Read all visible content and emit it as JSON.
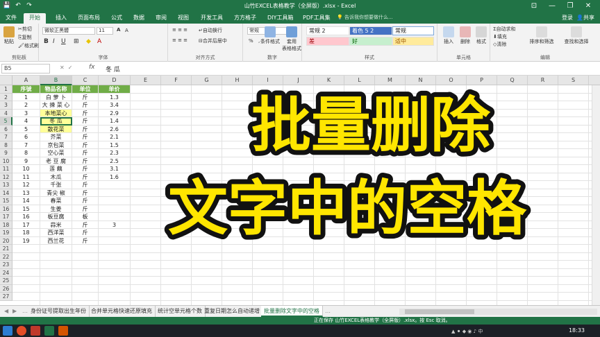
{
  "window": {
    "title": "山竹EXCEL表格教学（全屏版）.xlsx - Excel",
    "save_icon": "save-icon",
    "undo_icon": "undo-icon",
    "redo_icon": "redo-icon"
  },
  "ribbon_tabs": [
    "文件",
    "开始",
    "插入",
    "页面布局",
    "公式",
    "数据",
    "审阅",
    "视图",
    "开发工具",
    "方方格子",
    "DIY工具箱",
    "PDF工具集"
  ],
  "tell_me": "告诉我你想要做什么...",
  "account": {
    "login": "登录",
    "share": "共享"
  },
  "ribbon": {
    "clipboard": {
      "paste": "粘贴",
      "cut": "剪切",
      "copy": "复制",
      "format_painter": "格式刷",
      "label": "剪贴板"
    },
    "font": {
      "name": "微软正黑體",
      "size": "11",
      "grow": "A",
      "shrink": "A",
      "bold": "B",
      "italic": "I",
      "underline": "U",
      "label": "字体"
    },
    "align": {
      "wrap": "自动换行",
      "merge": "合并后居中",
      "label": "对齐方式"
    },
    "number": {
      "format": "常规",
      "pct": "%",
      "comma": ",",
      "label": "数字"
    },
    "styles": {
      "cond": "条件格式",
      "table": "套用\n表格格式",
      "label": "样式",
      "items": [
        "常规 2",
        "着色 5 2",
        "常规",
        "差",
        "好",
        "适中"
      ],
      "colors": {
        "bad": "#ffc7ce",
        "good": "#c6efce",
        "neutral": "#ffeb9c",
        "accent": "#4472c4"
      }
    },
    "cells": {
      "insert": "插入",
      "delete": "删除",
      "format": "格式",
      "label": "单元格"
    },
    "editing": {
      "autosum": "自动求和",
      "fill": "填充",
      "clear": "清除",
      "sort": "排序和筛选",
      "find": "查找和选择",
      "label": "编辑"
    }
  },
  "formula_bar": {
    "name_box": "B5",
    "fx": "fx",
    "value": "冬 瓜"
  },
  "columns": [
    "A",
    "B",
    "C",
    "D",
    "E",
    "F",
    "G",
    "H",
    "I",
    "J",
    "K",
    "L",
    "M",
    "N",
    "O",
    "P",
    "Q",
    "R",
    "S",
    "T"
  ],
  "rows": [
    "1",
    "2",
    "3",
    "4",
    "5",
    "6",
    "7",
    "8",
    "9",
    "10",
    "11",
    "12",
    "13",
    "14",
    "15",
    "16",
    "17",
    "18",
    "19",
    "20",
    "21",
    "22",
    "23",
    "24",
    "25",
    "26",
    "27"
  ],
  "table": {
    "headers": [
      "序號",
      "物品名称",
      "单位",
      "单价"
    ],
    "rows": [
      [
        "1",
        "白 萝 卜",
        "斤",
        "1.3"
      ],
      [
        "2",
        "大 揀 菜 心",
        "斤",
        "3.4"
      ],
      [
        "3",
        "本地菜心",
        "斤",
        "2.9"
      ],
      [
        "4",
        "冬 瓜",
        "斤",
        "1.4"
      ],
      [
        "5",
        "散花菜",
        "斤",
        "2.6"
      ],
      [
        "6",
        "芥菜",
        "斤",
        "2.1"
      ],
      [
        "7",
        "京包菜",
        "斤",
        "1.5"
      ],
      [
        "8",
        "空心菜",
        "斤",
        "2.3"
      ],
      [
        "9",
        "老 豆 腐",
        "斤",
        "2.5"
      ],
      [
        "10",
        "莲 藕",
        "斤",
        "3.1"
      ],
      [
        "11",
        "木瓜",
        "斤",
        "1.6"
      ],
      [
        "12",
        "千张",
        "斤",
        ""
      ],
      [
        "13",
        "青尖 椒",
        "斤",
        ""
      ],
      [
        "14",
        "春菜",
        "斤",
        ""
      ],
      [
        "15",
        "生姜",
        "斤",
        ""
      ],
      [
        "16",
        "板豆腐",
        "板",
        ""
      ],
      [
        "17",
        "蒜米",
        "斤",
        "3"
      ],
      [
        "18",
        "西洋菜",
        "斤",
        ""
      ],
      [
        "19",
        "西兰花",
        "斤",
        ""
      ]
    ]
  },
  "overlay": {
    "line1": "批量删除",
    "line2": "文字中的空格"
  },
  "sheet_tabs": [
    "身份证号提取出生年份",
    "合并单元格快速还原填充",
    "统计空单元格个数",
    "重复日期怎么自动递增",
    "批量删除文字中的空格"
  ],
  "status": {
    "message": "正在保存 山竹EXCEL表格教学（全屏版）.xlsx。按 Esc 取消。"
  },
  "taskbar": {
    "time": "18:33"
  }
}
